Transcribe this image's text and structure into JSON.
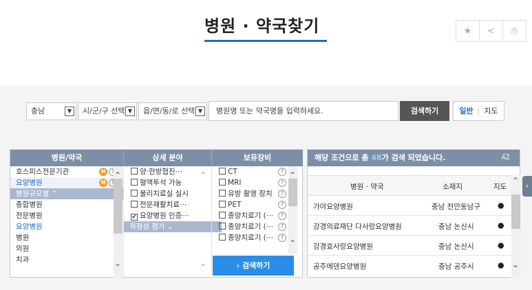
{
  "header": {
    "title": "병원 · 약국찾기",
    "tools": [
      {
        "icon": "star-icon",
        "glyph": "★"
      },
      {
        "icon": "share-icon",
        "glyph": "<"
      },
      {
        "icon": "print-icon",
        "glyph": "⎙"
      }
    ]
  },
  "search": {
    "province": "충남",
    "city_placeholder": "시/군/구 선택",
    "town_placeholder": "읍/면/동/로 선택",
    "query_placeholder": "병원명 또는 약국명을 입력하세요.",
    "search_label": "검색하기",
    "view_general": "일반",
    "view_map": "지도"
  },
  "filters": {
    "headers": [
      "병원/약국",
      "상세 분야",
      "보유장비"
    ],
    "types": [
      {
        "label": "호스피스전문기관",
        "badge_n": "N",
        "help": "?"
      },
      {
        "label": "요양병원",
        "badge_n": "N",
        "help": "?"
      }
    ],
    "size_group": "병원규모별 ⌃",
    "sizes": [
      "종합병원",
      "전문병원",
      "요양병원",
      "병원",
      "의원",
      "치과"
    ],
    "fields": [
      "양·한방협진⋯",
      "혈액투석 가능",
      "물리치료실 실시",
      "전문재활치료⋯",
      "요양병원 인증⋯"
    ],
    "fields_checked": [
      false,
      false,
      false,
      false,
      true
    ],
    "eval_group": "적정성 평가 ⌄",
    "equipment": [
      "CT",
      "MRI",
      "유방 촬영 장치",
      "PET",
      "종양치료기 (⋯",
      "종양치료기 (⋯",
      "종양치료기 (⋯"
    ],
    "help": "?",
    "search_label": "›  검색하기"
  },
  "results": {
    "summary_prefix": "해당 조건으로 총 ",
    "count": "48",
    "summary_suffix": "가 검색 되었습니다.",
    "sort_label": "A͡Z",
    "columns": [
      "병원 · 약국",
      "소재지",
      "지도"
    ],
    "rows": [
      {
        "name": "가야요양병원",
        "location": "충남 천안동남구"
      },
      {
        "name": "강경의료재단 다사랑요양병원",
        "location": "충남 논산시"
      },
      {
        "name": "강경효사랑요양병원",
        "location": "충남 논산시"
      },
      {
        "name": "공주에덴요양병원",
        "location": "충남 공주시"
      }
    ]
  },
  "colors": {
    "accent": "#1a6fc9",
    "header_bg": "#7d8fa6",
    "badge": "#f39a1d",
    "button_blue": "#2a8ee8"
  }
}
